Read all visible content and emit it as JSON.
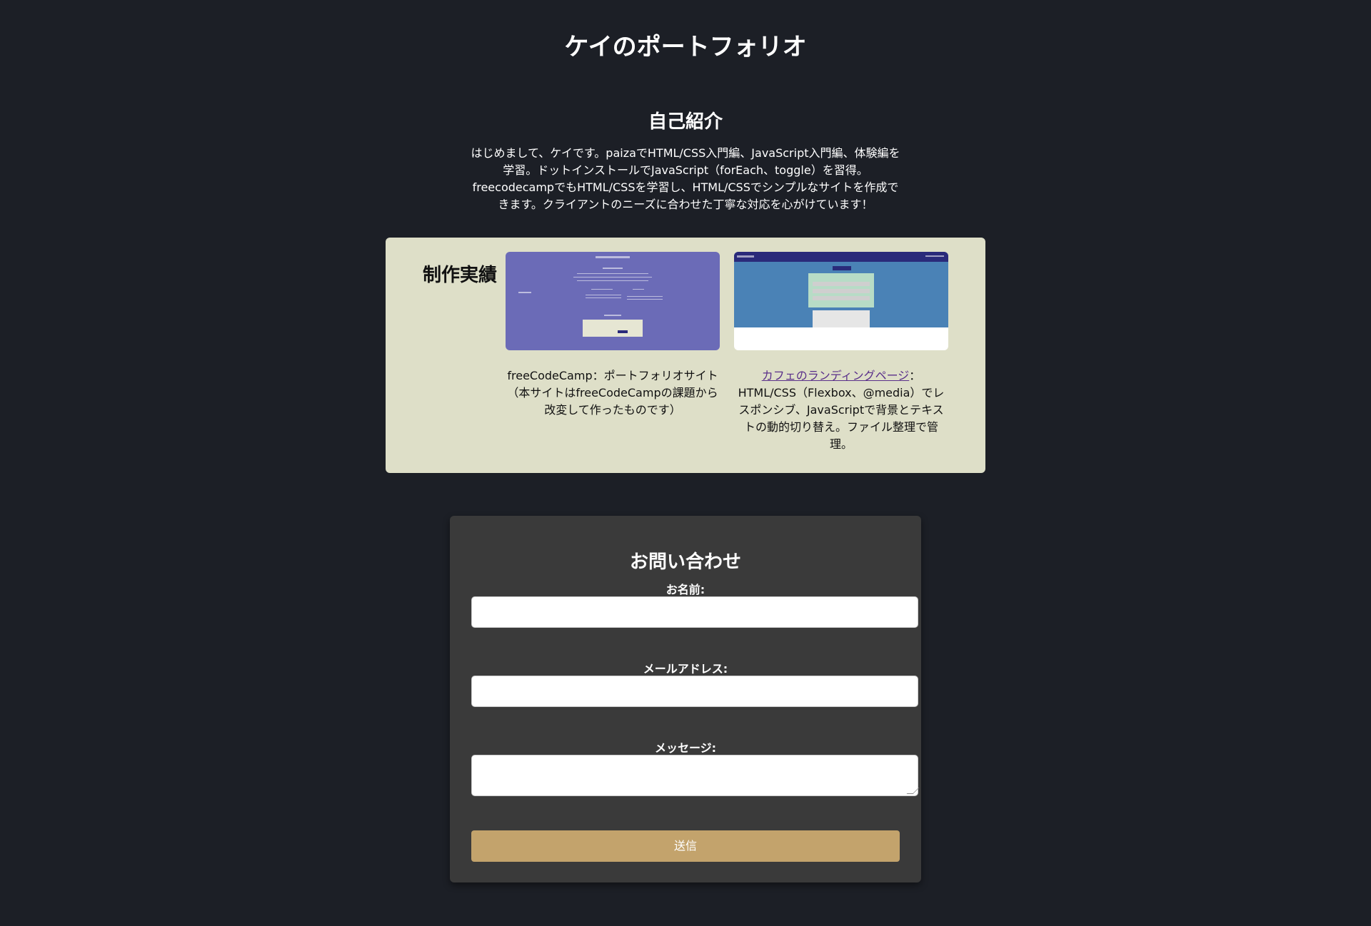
{
  "header": {
    "title": "ケイのポートフォリオ"
  },
  "about": {
    "heading": "自己紹介",
    "text": "はじめまして、ケイです。paizaでHTML/CSS入門編、JavaScript入門編、体験編を学習。ドットインストールでJavaScript（forEach、toggle）を習得。freecodecampでもHTML/CSSを学習し、HTML/CSSでシンプルなサイトを作成できます。クライアントのニーズに合わせた丁寧な対応を心がけています！"
  },
  "works": {
    "heading": "制作実績",
    "items": [
      {
        "description": "freeCodeCamp：ポートフォリオサイト（本サイトはfreeCodeCampの課題から改変して作ったものです）"
      },
      {
        "link_text": "カフェのランディングページ",
        "description": "：HTML/CSS（Flexbox、@media）でレスポンシブ、JavaScriptで背景とテキストの動的切り替え。ファイル整理で管理。"
      }
    ]
  },
  "contact": {
    "heading": "お問い合わせ",
    "name_label": "お名前:",
    "email_label": "メールアドレス:",
    "message_label": "メッセージ:",
    "name_value": "",
    "email_value": "",
    "message_value": "",
    "submit_label": "送信"
  },
  "colors": {
    "background": "#1c1f26",
    "works_panel": "#dedfc8",
    "contact_panel": "#3a3a3a",
    "submit_button": "#c3a36c",
    "link": "#5a2f8a",
    "thumb_portfolio": "#6b6bb7",
    "thumb_cafe": "#4a82b6"
  }
}
